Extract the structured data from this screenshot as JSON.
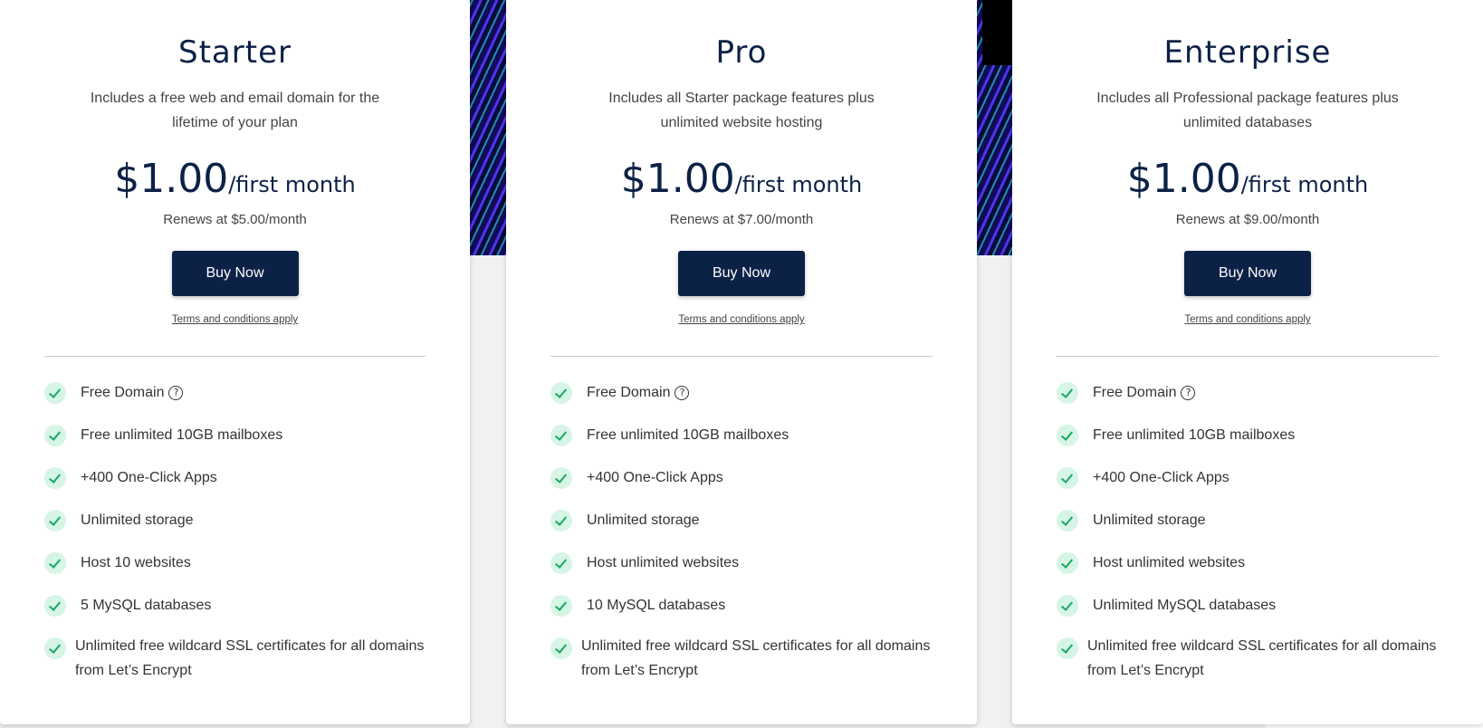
{
  "plans": [
    {
      "name": "Starter",
      "description": "Includes a free web and email domain for the lifetime of your plan",
      "price": "$1.00",
      "period": "/first month",
      "renews": "Renews at $5.00/month",
      "button_label": "Buy Now",
      "terms": "Terms and conditions apply",
      "features": [
        "Free Domain",
        "Free unlimited 10GB mailboxes",
        "+400 One-Click Apps",
        "Unlimited storage",
        "Host 10 websites",
        "5 MySQL databases",
        "Unlimited free wildcard SSL certificates for all domains from Let’s Encrypt"
      ]
    },
    {
      "name": "Pro",
      "description": "Includes all Starter package features plus unlimited website hosting",
      "price": "$1.00",
      "period": "/first month",
      "renews": "Renews at $7.00/month",
      "button_label": "Buy Now",
      "terms": "Terms and conditions apply",
      "features": [
        "Free Domain",
        "Free unlimited 10GB mailboxes",
        "+400 One-Click Apps",
        "Unlimited storage",
        "Host unlimited websites",
        "10 MySQL databases",
        "Unlimited free wildcard SSL certificates for all domains from Let’s Encrypt"
      ]
    },
    {
      "name": "Enterprise",
      "description": "Includes all Professional package features plus unlimited databases",
      "price": "$1.00",
      "period": "/first month",
      "renews": "Renews at $9.00/month",
      "button_label": "Buy Now",
      "terms": "Terms and conditions apply",
      "features": [
        "Free Domain",
        "Free unlimited 10GB mailboxes",
        "+400 One-Click Apps",
        "Unlimited storage",
        "Host unlimited websites",
        "Unlimited MySQL databases",
        "Unlimited free wildcard SSL certificates for all domains from Let’s Encrypt"
      ]
    }
  ],
  "icons": {
    "check": "check-circle-icon",
    "help": "question-circle-icon",
    "help_glyph": "?"
  },
  "colors": {
    "navy": "#0c2146",
    "check_green": "#1aa864",
    "check_bg": "#d6f5e6"
  }
}
